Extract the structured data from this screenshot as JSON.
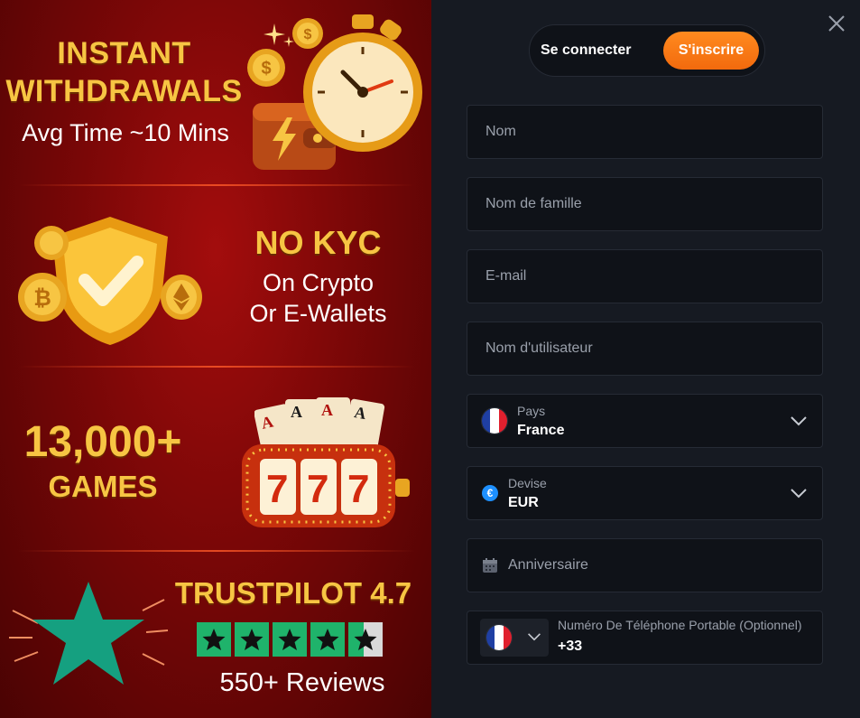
{
  "promo": {
    "withdrawals": {
      "title_line1": "INSTANT",
      "title_line2": "WITHDRAWALS",
      "subtitle": "Avg Time ~10 Mins"
    },
    "kyc": {
      "title": "NO KYC",
      "subtitle_line1": "On Crypto",
      "subtitle_line2": "Or E-Wallets"
    },
    "games": {
      "title": "13,000+",
      "subtitle": "GAMES"
    },
    "trustpilot": {
      "title": "TRUSTPILOT 4.7",
      "rating": 4.7,
      "max_rating": 5,
      "reviews": "550+ Reviews"
    },
    "icons": [
      "wallet-icon",
      "stopwatch-icon",
      "coin-icon",
      "shield-check-icon",
      "bitcoin-icon",
      "ethereum-icon",
      "cards-icon",
      "slot-machine-icon",
      "star-icon"
    ]
  },
  "form": {
    "tabs": {
      "login_label": "Se connecter",
      "signup_label": "S'inscrire",
      "active": "signup"
    },
    "fields": {
      "first_name_placeholder": "Nom",
      "last_name_placeholder": "Nom de famille",
      "email_placeholder": "E-mail",
      "username_placeholder": "Nom d'utilisateur"
    },
    "country": {
      "label": "Pays",
      "value": "France"
    },
    "currency": {
      "label": "Devise",
      "value": "EUR",
      "symbol": "€"
    },
    "birthday": {
      "placeholder": "Anniversaire"
    },
    "phone": {
      "label": "Numéro De Téléphone Portable (Optionnel)",
      "code": "+33"
    }
  },
  "colors": {
    "accent": "#f26a0d",
    "gold": "#f7c543",
    "panel_bg": "#161a22",
    "field_bg": "#0f1218",
    "trustpilot_green": "#1fb36b"
  }
}
